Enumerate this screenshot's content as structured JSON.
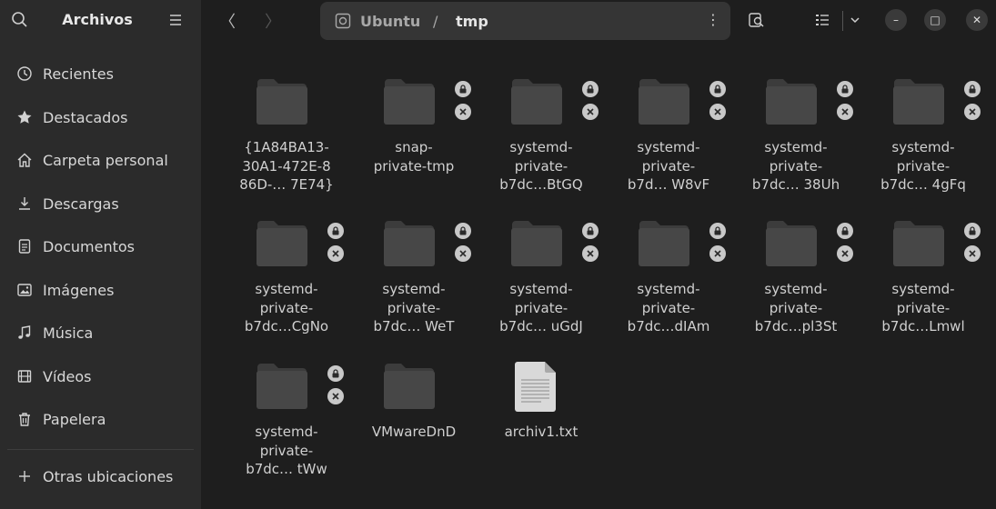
{
  "sidebar": {
    "title": "Archivos",
    "items": [
      {
        "label": "Recientes",
        "icon": "clock-icon"
      },
      {
        "label": "Destacados",
        "icon": "star-icon"
      },
      {
        "label": "Carpeta personal",
        "icon": "home-icon"
      },
      {
        "label": "Descargas",
        "icon": "download-icon"
      },
      {
        "label": "Documentos",
        "icon": "document-icon"
      },
      {
        "label": "Imágenes",
        "icon": "image-icon"
      },
      {
        "label": "Música",
        "icon": "music-icon"
      },
      {
        "label": "Vídeos",
        "icon": "video-icon"
      },
      {
        "label": "Papelera",
        "icon": "trash-icon"
      }
    ],
    "other_locations": {
      "label": "Otras ubicaciones",
      "icon": "plus-icon"
    }
  },
  "nav": {
    "back": "〈",
    "forward": "〉"
  },
  "path": {
    "root": "Ubuntu",
    "separator": "/",
    "current": "tmp",
    "menu": "⋮"
  },
  "window": {
    "minimize": "–",
    "maximize": "□",
    "close": "✕"
  },
  "files": [
    {
      "label": "{1A84BA13-\n30A1-472E-8\n86D-… 7E74}",
      "type": "folder",
      "locked": false
    },
    {
      "label": "snap-\nprivate-tmp",
      "type": "folder",
      "locked": true
    },
    {
      "label": "systemd-\nprivate-\nb7dc…BtGQ",
      "type": "folder",
      "locked": true
    },
    {
      "label": "systemd-\nprivate-\nb7d… W8vF",
      "type": "folder",
      "locked": true
    },
    {
      "label": "systemd-\nprivate-\nb7dc… 38Uh",
      "type": "folder",
      "locked": true
    },
    {
      "label": "systemd-\nprivate-\nb7dc… 4gFq",
      "type": "folder",
      "locked": true
    },
    {
      "label": "systemd-\nprivate-\nb7dc…CgNo",
      "type": "folder",
      "locked": true
    },
    {
      "label": "systemd-\nprivate-\nb7dc… WeT",
      "type": "folder",
      "locked": true
    },
    {
      "label": "systemd-\nprivate-\nb7dc… uGdJ",
      "type": "folder",
      "locked": true
    },
    {
      "label": "systemd-\nprivate-\nb7dc…dIAm",
      "type": "folder",
      "locked": true
    },
    {
      "label": "systemd-\nprivate-\nb7dc…pl3St",
      "type": "folder",
      "locked": true
    },
    {
      "label": "systemd-\nprivate-\nb7dc…Lmwl",
      "type": "folder",
      "locked": true
    },
    {
      "label": "systemd-\nprivate-\nb7dc… tWw",
      "type": "folder",
      "locked": true
    },
    {
      "label": "VMwareDnD",
      "type": "folder",
      "locked": false
    },
    {
      "label": "archiv1.txt",
      "type": "text-file",
      "locked": false
    }
  ],
  "colors": {
    "sidebar_bg": "#2b2b2b",
    "main_bg": "#1e1e1e",
    "pathbar_bg": "#353535",
    "folder": "#474747",
    "folder_tab": "#3c3c3c"
  }
}
